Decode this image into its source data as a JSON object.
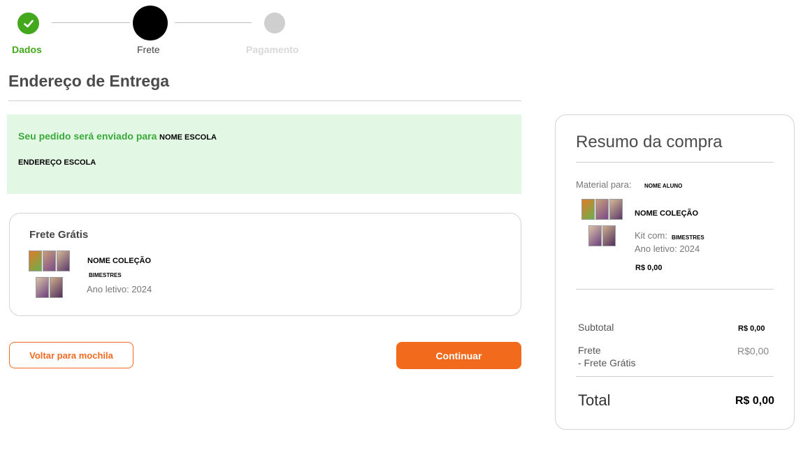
{
  "stepper": {
    "steps": [
      {
        "label": "Dados",
        "state": "done"
      },
      {
        "label": "Frete",
        "state": "active"
      },
      {
        "label": "Pagamento",
        "state": "todo"
      }
    ]
  },
  "address": {
    "title": "Endereço de Entrega",
    "intro": "Seu pedido será enviado para",
    "school_name": "NOME ESCOLA",
    "school_address": "ENDEREÇO ESCOLA"
  },
  "shipping": {
    "title": "Frete Grátis",
    "collection_name": "NOME COLEÇÃO",
    "kit": "BIMESTRES",
    "year": "Ano letivo: 2024"
  },
  "actions": {
    "back_label": "Voltar para mochila",
    "continue_label": "Continuar"
  },
  "summary": {
    "title": "Resumo da compra",
    "material_label": "Material para:",
    "student_name": "NOME ALUNO",
    "collection_name": "NOME COLEÇÃO",
    "kit_label": "Kit com:",
    "kit_value": "BIMESTRES",
    "year": "Ano letivo: 2024",
    "item_price": "R$ 0,00",
    "subtotal_label": "Subtotal",
    "subtotal_value": "R$ 0,00",
    "frete_label": "Frete",
    "frete_sub": "- Frete Grátis",
    "frete_value": "R$0,00",
    "total_label": "Total",
    "total_value": "R$ 0,00"
  },
  "colors": {
    "success": "#43a81b",
    "accent": "#f26a1c",
    "address_bg": "#e2f8e4"
  }
}
